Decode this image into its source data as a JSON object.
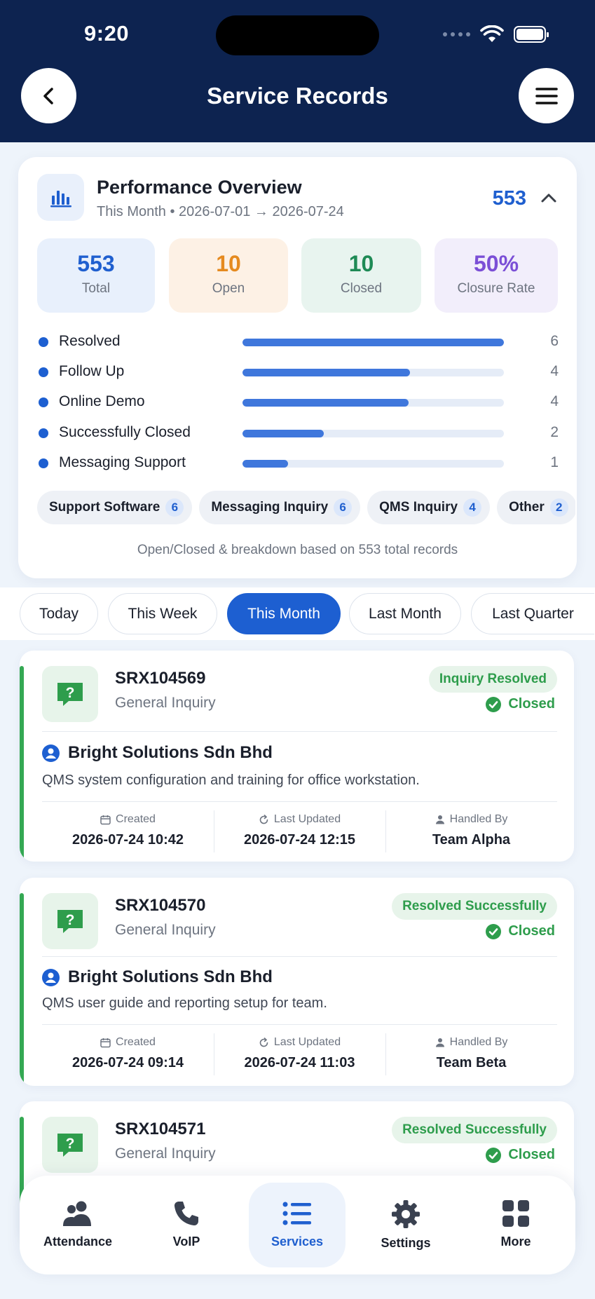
{
  "status_bar": {
    "time": "9:20"
  },
  "header": {
    "title": "Service Records"
  },
  "overview": {
    "title": "Performance Overview",
    "subtitle": "This Month • 2026-07-01 → 2026-07-24",
    "count": "553",
    "stats": [
      {
        "value": "553",
        "label": "Total",
        "color": "#1f5fcf"
      },
      {
        "value": "10",
        "label": "Open",
        "color": "#e58a1f"
      },
      {
        "value": "10",
        "label": "Closed",
        "color": "#1e8a55"
      },
      {
        "value": "50%",
        "label": "Closure Rate",
        "color": "#7b4fd6"
      }
    ],
    "breakdown": [
      {
        "name": "Resolved",
        "count": "6",
        "fraction": 1.0
      },
      {
        "name": "Follow Up",
        "count": "4",
        "fraction": 0.64
      },
      {
        "name": "Online Demo",
        "count": "4",
        "fraction": 0.635
      },
      {
        "name": "Successfully Closed",
        "count": "2",
        "fraction": 0.31
      },
      {
        "name": "Messaging Support",
        "count": "1",
        "fraction": 0.175
      }
    ],
    "chips": [
      {
        "label": "Support Software",
        "count": "6"
      },
      {
        "label": "Messaging Inquiry",
        "count": "6"
      },
      {
        "label": "QMS Inquiry",
        "count": "4"
      },
      {
        "label": "Other",
        "count": "2"
      }
    ],
    "footer": "Open/Closed & breakdown based on 553 total records"
  },
  "filters": [
    "Today",
    "This Week",
    "This Month",
    "Last Month",
    "Last Quarter"
  ],
  "records": [
    {
      "id": "SRX104569",
      "type": "General Inquiry",
      "status": "Inquiry Resolved",
      "state": "Closed",
      "client": "Bright Solutions Sdn Bhd",
      "description": "QMS system configuration and training for office workstation.",
      "created_label": "Created",
      "created": "2026-07-24 10:42",
      "updated_label": "Last Updated",
      "updated": "2026-07-24 12:15",
      "handled_label": "Handled By",
      "handled": "Team Alpha"
    },
    {
      "id": "SRX104570",
      "type": "General Inquiry",
      "status": "Resolved Successfully",
      "state": "Closed",
      "client": "Bright Solutions Sdn Bhd",
      "description": "QMS user guide and reporting setup for team.",
      "created_label": "Created",
      "created": "2026-07-24 09:14",
      "updated_label": "Last Updated",
      "updated": "2026-07-24 11:03",
      "handled_label": "Handled By",
      "handled": "Team Beta"
    },
    {
      "id": "SRX104571",
      "type": "General Inquiry",
      "status": "Resolved Successfully",
      "state": "Closed"
    }
  ],
  "tabs": [
    {
      "label": "Attendance",
      "icon": "users-icon"
    },
    {
      "label": "VoIP",
      "icon": "phone-icon"
    },
    {
      "label": "Services",
      "icon": "list-icon"
    },
    {
      "label": "Settings",
      "icon": "gear-icon"
    },
    {
      "label": "More",
      "icon": "grid-icon"
    }
  ],
  "colors": {
    "header": "#0d2350",
    "accent": "#1d5fd1",
    "success": "#2e9d4c"
  }
}
